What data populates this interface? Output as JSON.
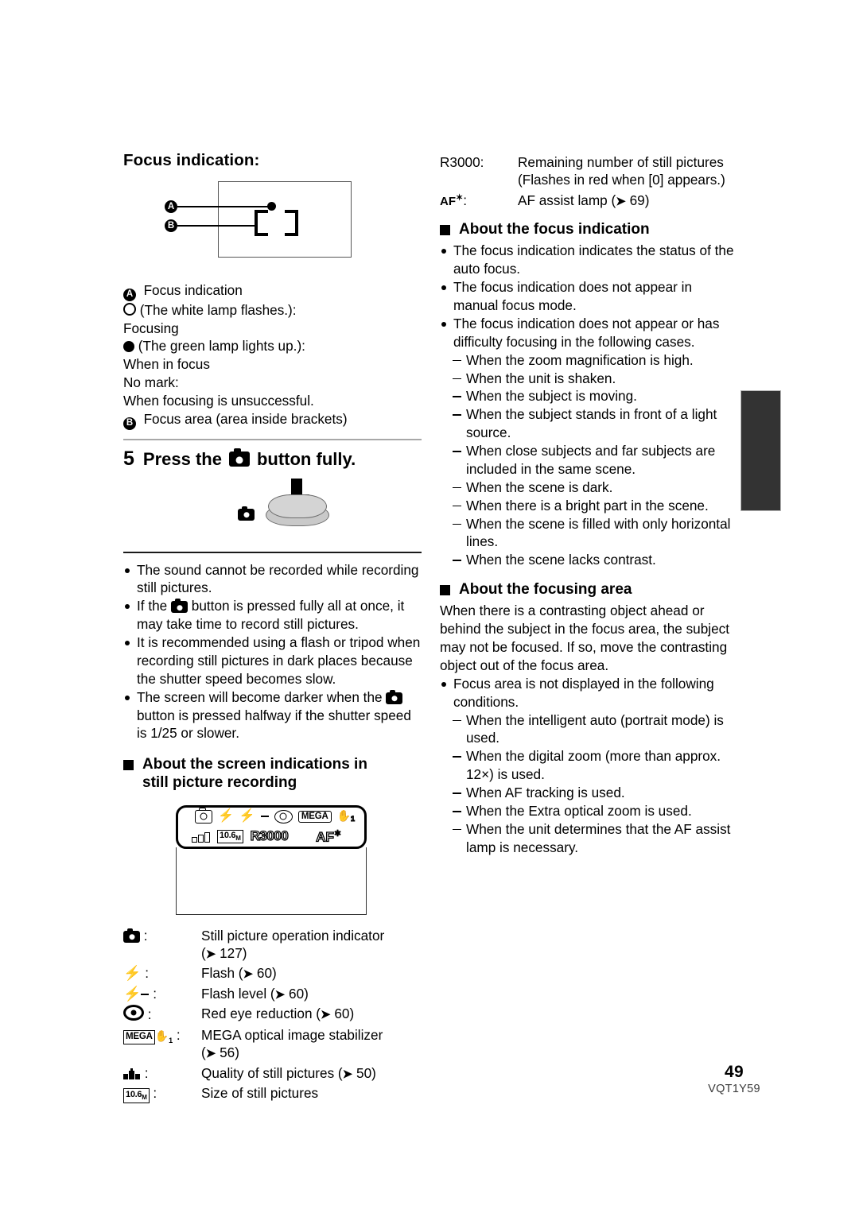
{
  "document": {
    "page_number": "49",
    "doc_code": "VQT1Y59"
  },
  "left_column": {
    "focus_indication_heading": "Focus indication:",
    "figure_focus": {
      "marker_a": "A",
      "marker_b": "B"
    },
    "legend": {
      "a_marker": "A",
      "a_label": "Focus indication",
      "white_lamp_text": "(The white lamp flashes.):",
      "focusing_text": "Focusing",
      "green_lamp_text": "(The green lamp lights up.):",
      "in_focus_text": "When in focus",
      "no_mark_text": "No mark:",
      "unsuccessful_text": "When focusing is unsuccessful.",
      "b_marker": "B",
      "b_label": "Focus area (area inside brackets)"
    },
    "step": {
      "number": "5",
      "text_before": "Press the",
      "icon": "camera-button-icon",
      "text_after": "button fully."
    },
    "notes": [
      "The sound cannot be recorded while recording still pictures.",
      "If the ■ button is pressed fully all at once, it may take time to record still pictures.",
      "It is recommended using a flash or tripod when recording still pictures in dark places because the shutter speed becomes slow.",
      "The screen will become darker when the ■ button is pressed halfway if the shutter speed is 1/25 or slower."
    ],
    "notes_parts": {
      "note1": "The sound cannot be recorded while recording still pictures.",
      "note2_a": "If the",
      "note2_b": "button is pressed fully all at once, it may take time to record still pictures.",
      "note3": "It is recommended using a flash or tripod when recording still pictures in dark places because the shutter speed becomes slow.",
      "note4_a": "The screen will become darker when the",
      "note4_b": "button is pressed halfway if the shutter speed is 1/25 or slower."
    },
    "screen_heading_line1": "About the screen indications in",
    "screen_heading_line2": "still picture recording",
    "screen_figure": {
      "camera_icon": "camera-icon",
      "flash_icon": "flash-icon",
      "flash_level_icon": "flash-level-icon",
      "red_eye_icon": "red-eye-icon",
      "mega_label": "MEGA",
      "ois_icon": "image-stabilizer-icon",
      "ois_sub": "1",
      "quality_icon": "quality-icon",
      "size_label": "10.6",
      "size_unit": "M",
      "remaining_label": "R3000",
      "af_label": "AF",
      "af_star": "✶"
    },
    "icon_legend": [
      {
        "symbol": "still-picture-operation-icon",
        "desc": "Still picture operation indicator",
        "desc2": "(➔ 127)"
      },
      {
        "symbol": "flash-icon",
        "desc": "Flash (➔ 60)"
      },
      {
        "symbol": "flash-level-icon",
        "desc": "Flash level (➔ 60)"
      },
      {
        "symbol": "red-eye-icon",
        "desc": "Red eye reduction (➔ 60)"
      },
      {
        "symbol": "mega-ois-icon",
        "desc": "MEGA optical image stabilizer",
        "desc2": "(➔ 56)"
      },
      {
        "symbol": "quality-icon",
        "desc": "Quality of still pictures (➔ 50)"
      },
      {
        "symbol": "size-icon",
        "desc": "Size of still pictures"
      }
    ],
    "legend_rows": {
      "row1_desc": "Still picture operation indicator",
      "row1_desc2": "127",
      "row2_desc": "Flash (",
      "row2_ref": "60",
      "row3_desc": "Flash level (",
      "row3_ref": "60",
      "row4_desc": "Red eye reduction (",
      "row4_ref": "60",
      "row5_desc": "MEGA optical image stabilizer",
      "row5_ref": "56",
      "row6_desc": "Quality of still pictures (",
      "row6_ref": "50",
      "row7_desc": "Size of still pictures",
      "mega_label": "MEGA",
      "size_num": "10.6",
      "size_unit": "M"
    }
  },
  "right_column": {
    "top_legend": {
      "r3000_symbol": "R3000:",
      "r3000_desc": "Remaining number of still pictures",
      "r3000_desc2": "(Flashes in red when [0] appears.)",
      "af_symbol": "AF",
      "af_star": "✶",
      "af_colon": ":",
      "af_desc": "AF assist lamp (",
      "af_ref": "69"
    },
    "focus_heading": "About the focus indication",
    "focus_bullets": [
      "The focus indication indicates the status of the auto focus.",
      "The focus indication does not appear in manual focus mode.",
      "The focus indication does not appear or has difficulty focusing in the following cases."
    ],
    "focus_cases": [
      "When the zoom magnification is high.",
      "When the unit is shaken.",
      "When the subject is moving.",
      "When the subject stands in front of a light source.",
      "When close subjects and far subjects are included in the same scene.",
      "When the scene is dark.",
      "When there is a bright part in the scene.",
      "When the scene is filled with only horizontal lines.",
      "When the scene lacks contrast."
    ],
    "area_heading": "About the focusing area",
    "area_paragraph": "When there is a contrasting object ahead or behind the subject in the focus area, the subject may not be focused. If so, move the contrasting object out of the focus area.",
    "area_bullet": "Focus area is not displayed in the following conditions.",
    "area_cases": [
      "When the intelligent auto (portrait mode) is used.",
      "When the digital zoom (more than approx. 12×) is used.",
      "When AF tracking is used.",
      "When the Extra optical zoom is used.",
      "When the unit determines that the AF assist lamp is necessary."
    ]
  }
}
